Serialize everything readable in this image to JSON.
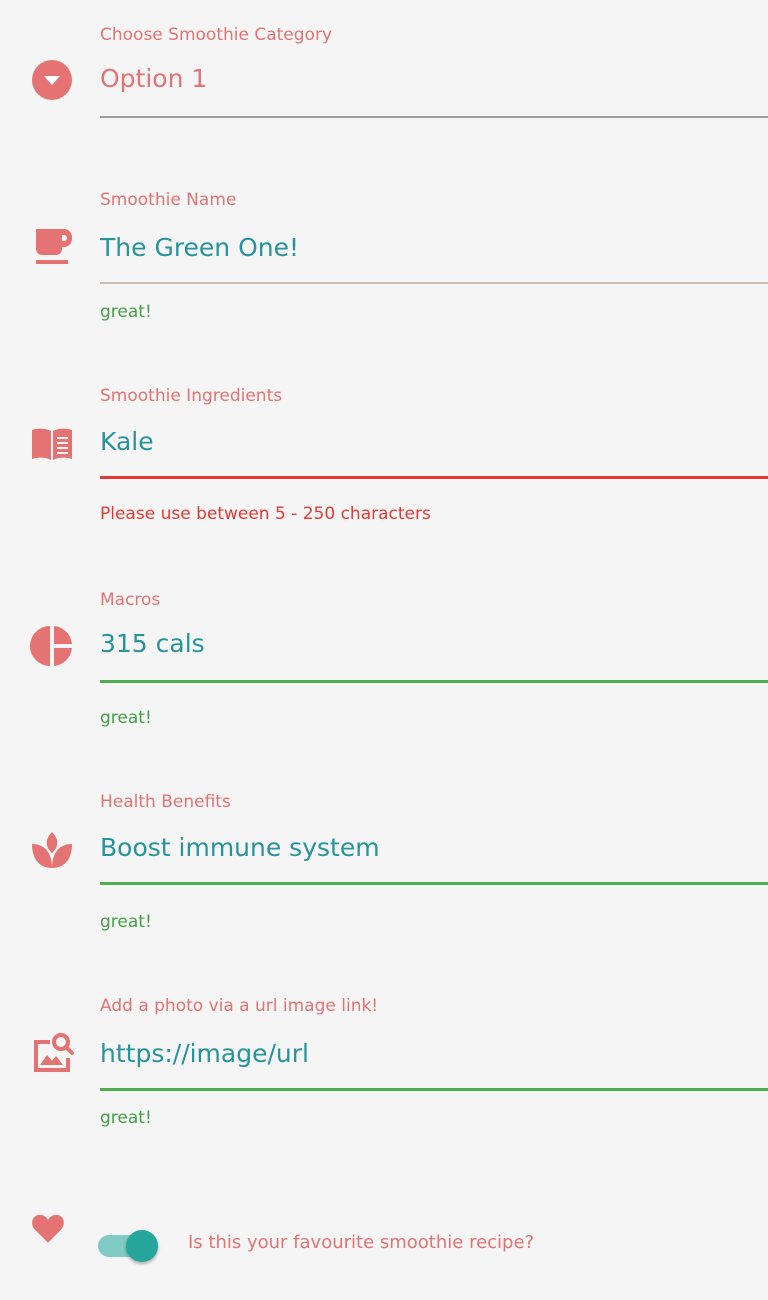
{
  "colors": {
    "accent": "#e57373",
    "value_text": "#26949b",
    "success": "#43a047",
    "error": "#e53935",
    "toggle_on": "#26a69a"
  },
  "category": {
    "label": "Choose Smoothie Category",
    "value": "Option 1",
    "icon": "dropdown-circle-icon"
  },
  "name": {
    "label": "Smoothie Name",
    "value": "The Green One!",
    "hint": "great!",
    "icon": "coffee-cup-icon"
  },
  "ingredients": {
    "label": "Smoothie Ingredients",
    "value": "Kale",
    "error": "Please use between 5 - 250 characters",
    "icon": "book-icon"
  },
  "macros": {
    "label": "Macros",
    "value": "315 cals",
    "hint": "great!",
    "icon": "pie-chart-icon"
  },
  "benefits": {
    "label": "Health Benefits",
    "value": "Boost immune system",
    "hint": "great!",
    "icon": "spa-icon"
  },
  "photo": {
    "label": "Add a photo via a url image link!",
    "value": "https://image/url",
    "hint": "great!",
    "icon": "image-search-icon"
  },
  "favourite": {
    "label": "Is this your favourite smoothie recipe?",
    "checked": true,
    "icon": "heart-icon"
  }
}
